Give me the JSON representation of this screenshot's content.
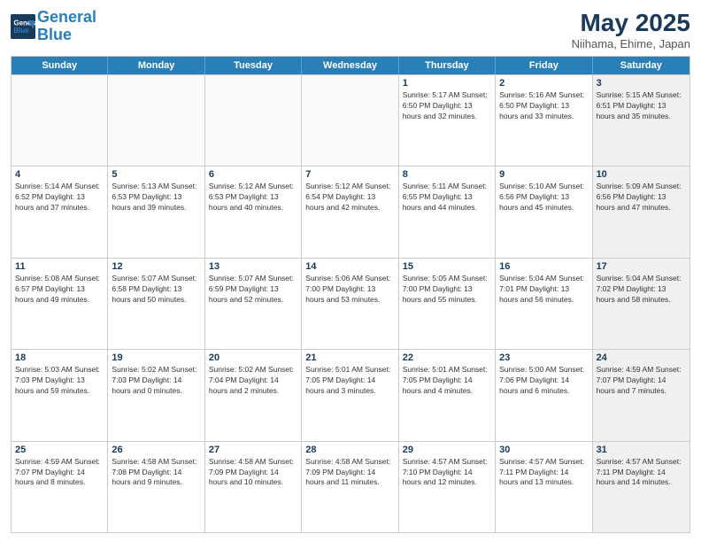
{
  "header": {
    "logo_line1": "General",
    "logo_line2": "Blue",
    "month_title": "May 2025",
    "location": "Niihama, Ehime, Japan"
  },
  "day_headers": [
    "Sunday",
    "Monday",
    "Tuesday",
    "Wednesday",
    "Thursday",
    "Friday",
    "Saturday"
  ],
  "weeks": [
    [
      {
        "day": "",
        "empty": true
      },
      {
        "day": "",
        "empty": true
      },
      {
        "day": "",
        "empty": true
      },
      {
        "day": "",
        "empty": true
      },
      {
        "day": "1",
        "info": "Sunrise: 5:17 AM\nSunset: 6:50 PM\nDaylight: 13 hours\nand 32 minutes."
      },
      {
        "day": "2",
        "info": "Sunrise: 5:16 AM\nSunset: 6:50 PM\nDaylight: 13 hours\nand 33 minutes."
      },
      {
        "day": "3",
        "info": "Sunrise: 5:15 AM\nSunset: 6:51 PM\nDaylight: 13 hours\nand 35 minutes.",
        "shaded": true
      }
    ],
    [
      {
        "day": "4",
        "info": "Sunrise: 5:14 AM\nSunset: 6:52 PM\nDaylight: 13 hours\nand 37 minutes."
      },
      {
        "day": "5",
        "info": "Sunrise: 5:13 AM\nSunset: 6:53 PM\nDaylight: 13 hours\nand 39 minutes."
      },
      {
        "day": "6",
        "info": "Sunrise: 5:12 AM\nSunset: 6:53 PM\nDaylight: 13 hours\nand 40 minutes."
      },
      {
        "day": "7",
        "info": "Sunrise: 5:12 AM\nSunset: 6:54 PM\nDaylight: 13 hours\nand 42 minutes."
      },
      {
        "day": "8",
        "info": "Sunrise: 5:11 AM\nSunset: 6:55 PM\nDaylight: 13 hours\nand 44 minutes."
      },
      {
        "day": "9",
        "info": "Sunrise: 5:10 AM\nSunset: 6:56 PM\nDaylight: 13 hours\nand 45 minutes."
      },
      {
        "day": "10",
        "info": "Sunrise: 5:09 AM\nSunset: 6:56 PM\nDaylight: 13 hours\nand 47 minutes.",
        "shaded": true
      }
    ],
    [
      {
        "day": "11",
        "info": "Sunrise: 5:08 AM\nSunset: 6:57 PM\nDaylight: 13 hours\nand 49 minutes."
      },
      {
        "day": "12",
        "info": "Sunrise: 5:07 AM\nSunset: 6:58 PM\nDaylight: 13 hours\nand 50 minutes."
      },
      {
        "day": "13",
        "info": "Sunrise: 5:07 AM\nSunset: 6:59 PM\nDaylight: 13 hours\nand 52 minutes."
      },
      {
        "day": "14",
        "info": "Sunrise: 5:06 AM\nSunset: 7:00 PM\nDaylight: 13 hours\nand 53 minutes."
      },
      {
        "day": "15",
        "info": "Sunrise: 5:05 AM\nSunset: 7:00 PM\nDaylight: 13 hours\nand 55 minutes."
      },
      {
        "day": "16",
        "info": "Sunrise: 5:04 AM\nSunset: 7:01 PM\nDaylight: 13 hours\nand 56 minutes."
      },
      {
        "day": "17",
        "info": "Sunrise: 5:04 AM\nSunset: 7:02 PM\nDaylight: 13 hours\nand 58 minutes.",
        "shaded": true
      }
    ],
    [
      {
        "day": "18",
        "info": "Sunrise: 5:03 AM\nSunset: 7:03 PM\nDaylight: 13 hours\nand 59 minutes."
      },
      {
        "day": "19",
        "info": "Sunrise: 5:02 AM\nSunset: 7:03 PM\nDaylight: 14 hours\nand 0 minutes."
      },
      {
        "day": "20",
        "info": "Sunrise: 5:02 AM\nSunset: 7:04 PM\nDaylight: 14 hours\nand 2 minutes."
      },
      {
        "day": "21",
        "info": "Sunrise: 5:01 AM\nSunset: 7:05 PM\nDaylight: 14 hours\nand 3 minutes."
      },
      {
        "day": "22",
        "info": "Sunrise: 5:01 AM\nSunset: 7:05 PM\nDaylight: 14 hours\nand 4 minutes."
      },
      {
        "day": "23",
        "info": "Sunrise: 5:00 AM\nSunset: 7:06 PM\nDaylight: 14 hours\nand 6 minutes."
      },
      {
        "day": "24",
        "info": "Sunrise: 4:59 AM\nSunset: 7:07 PM\nDaylight: 14 hours\nand 7 minutes.",
        "shaded": true
      }
    ],
    [
      {
        "day": "25",
        "info": "Sunrise: 4:59 AM\nSunset: 7:07 PM\nDaylight: 14 hours\nand 8 minutes."
      },
      {
        "day": "26",
        "info": "Sunrise: 4:58 AM\nSunset: 7:08 PM\nDaylight: 14 hours\nand 9 minutes."
      },
      {
        "day": "27",
        "info": "Sunrise: 4:58 AM\nSunset: 7:09 PM\nDaylight: 14 hours\nand 10 minutes."
      },
      {
        "day": "28",
        "info": "Sunrise: 4:58 AM\nSunset: 7:09 PM\nDaylight: 14 hours\nand 11 minutes."
      },
      {
        "day": "29",
        "info": "Sunrise: 4:57 AM\nSunset: 7:10 PM\nDaylight: 14 hours\nand 12 minutes."
      },
      {
        "day": "30",
        "info": "Sunrise: 4:57 AM\nSunset: 7:11 PM\nDaylight: 14 hours\nand 13 minutes."
      },
      {
        "day": "31",
        "info": "Sunrise: 4:57 AM\nSunset: 7:11 PM\nDaylight: 14 hours\nand 14 minutes.",
        "shaded": true
      }
    ]
  ]
}
